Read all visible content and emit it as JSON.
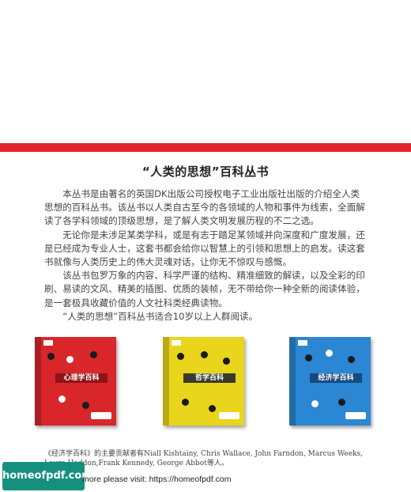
{
  "title": "“人类的思想”百科丛书",
  "paragraphs": [
    "本丛书是由著名的英国DK出版公司授权电子工业出版社出版的介绍全人类思想的百科丛书。该丛书以人类自古至今的各领域的人物和事件为线索，全面解读了各学科领域的顶级思想，是了解人类文明发展历程的不二之选。",
    "无论你是未涉足某类学科，或是有志于踏足某领域并向深度和广度发展，还是已经成为专业人士，这套书都会给你以智慧上的引领和思想上的启发。读这套书就像与人类历史上的伟大灵魂对话，让你无不惊叹与感慨。",
    "该丛书包罗万象的内容、科学严谨的结构、精准细致的解读，以及全彩的印刷、易读的文风、精美的插图、优质的装帧，无不带给你一种全新的阅读体验，是一套极具收藏价值的人文社科类经典读物。",
    "“人类的思想”百科丛书适合10岁以上人群阅读。"
  ],
  "books": [
    {
      "title": "心理学百科",
      "color": "#d8262a"
    },
    {
      "title": "哲学百科",
      "color": "#e9d51c"
    },
    {
      "title": "经济学百科",
      "color": "#2b86d3"
    }
  ],
  "caption": "《经济学百科》的主要贡献者有Niall Kishtainy, Chris Wallace, John Farndon, Marcus Weeks, Laura Haddon,Frank Kennedy, George Abbot等人。",
  "badge": "homeofpdf.com",
  "more_text": "more please visit: https://homeofpdf.com",
  "colors": {
    "accent_red": "#e2262b",
    "badge_green": "#15907f"
  }
}
